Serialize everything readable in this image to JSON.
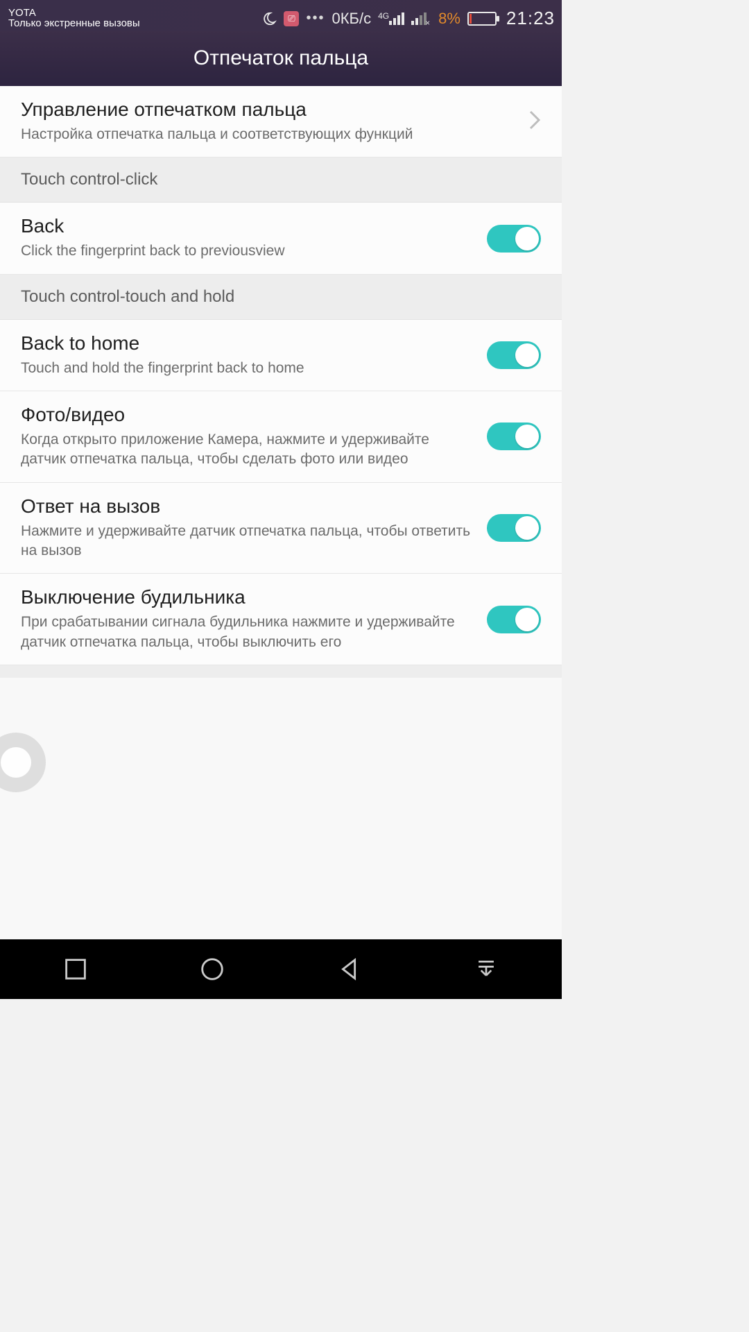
{
  "statusbar": {
    "operator": "YOTA",
    "emergency": "Только экстренные вызовы",
    "speed": "0КБ/с",
    "network_badge": "4G",
    "battery_percent": "8%",
    "clock": "21:23"
  },
  "header": {
    "title": "Отпечаток пальца"
  },
  "rows": {
    "manage": {
      "title": "Управление отпечатком пальца",
      "sub": "Настройка отпечатка пальца и соответствующих функций"
    },
    "section_click": "Touch control-click",
    "back": {
      "title": "Back",
      "sub": "Click the fingerprint back to previousview"
    },
    "section_hold": "Touch control-touch and hold",
    "home": {
      "title": "Back to home",
      "sub": "Touch and hold the fingerprint back to home"
    },
    "photo": {
      "title": "Фото/видео",
      "sub": "Когда открыто приложение Камера, нажмите и удерживайте датчик отпечатка пальца, чтобы сделать фото или видео"
    },
    "call": {
      "title": "Ответ на вызов",
      "sub": "Нажмите и удерживайте датчик отпечатка пальца, чтобы ответить на вызов"
    },
    "alarm": {
      "title": "Выключение будильника",
      "sub": "При срабатывании сигнала будильника нажмите и удерживайте датчик отпечатка пальца, чтобы выключить его"
    }
  },
  "toggles": {
    "back": true,
    "home": true,
    "photo": true,
    "call": true,
    "alarm": true
  }
}
